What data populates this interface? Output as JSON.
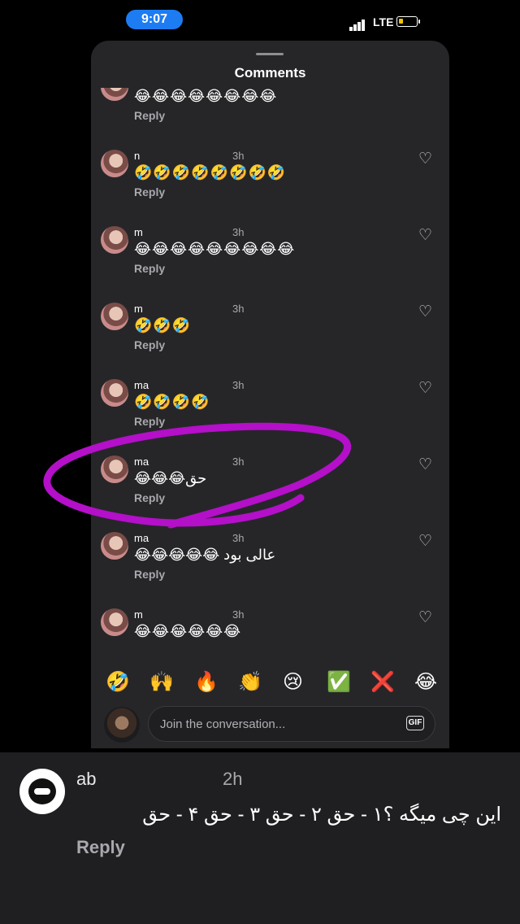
{
  "status_bar": {
    "time": "9:07",
    "network": "LTE"
  },
  "sheet": {
    "title": "Comments"
  },
  "comments": [
    {
      "username": "",
      "time": "",
      "text": "😂😂😂😂😂😂😂😂",
      "reply": "Reply"
    },
    {
      "username": "n",
      "time": "3h",
      "text": "🤣🤣🤣🤣🤣🤣🤣🤣",
      "reply": "Reply"
    },
    {
      "username": "m",
      "time": "3h",
      "text": "😂😂😂😂😂😂😂😂😂",
      "reply": "Reply"
    },
    {
      "username": "m",
      "time": "3h",
      "text": "🤣🤣🤣",
      "reply": "Reply"
    },
    {
      "username": "ma",
      "time": "3h",
      "text": "🤣🤣🤣🤣",
      "reply": "Reply"
    },
    {
      "username": "ma",
      "time": "3h",
      "text": "😂😂😂حق",
      "reply": "Reply"
    },
    {
      "username": "ma",
      "time": "3h",
      "text": "😂😂😂😂😂 عالی بود",
      "reply": "Reply"
    },
    {
      "username": "m",
      "time": "3h",
      "text": "😂😂😂😂😂😂",
      "reply": "Reply"
    }
  ],
  "quick_emojis": [
    "🤣",
    "🙌",
    "🔥",
    "👏",
    "😢",
    "✅",
    "❌",
    "😂"
  ],
  "composer": {
    "placeholder": "Join the conversation...",
    "gif_label": "GIF"
  },
  "highlight_color": "#b40fc9",
  "bottom_comment": {
    "username": "ab",
    "time": "2h",
    "text": "این چی میگه ؟۱ - حق ۲ - حق ۳ - حق ۴ - حق",
    "reply": "Reply"
  }
}
